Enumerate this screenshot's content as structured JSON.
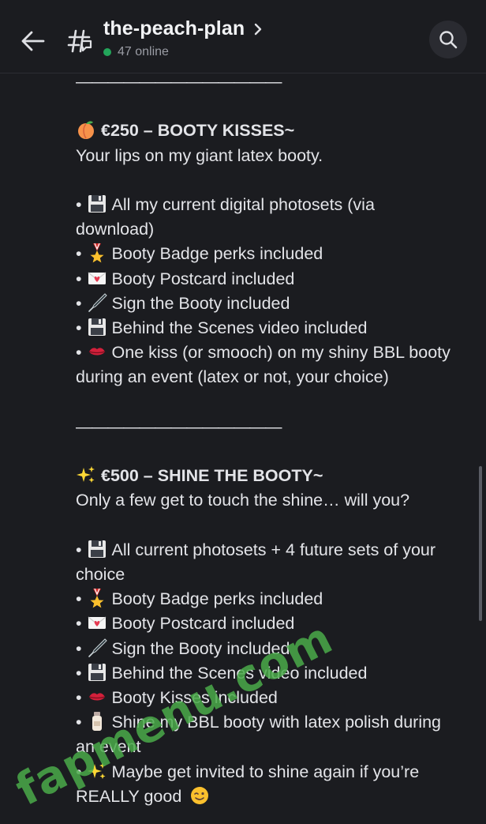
{
  "header": {
    "back_icon": "arrow-left-icon",
    "channel_icon": "hash-thread-icon",
    "channel_name": "the-peach-plan",
    "chevron_icon": "chevron-right-icon",
    "online_text": "47 online",
    "online_color": "#23a55a",
    "search_icon": "search-icon"
  },
  "message": {
    "divider_1": "—————————————",
    "tier_1": {
      "emoji": "peach-icon",
      "title": "€250 – BOOTY KISSES~",
      "subtitle": "Your lips on my giant latex booty.",
      "items": [
        {
          "emoji": "floppy-disk-icon",
          "text": "All my current digital photosets (via",
          "cont": "download)"
        },
        {
          "emoji": "military-medal-icon",
          "text": "Booty Badge perks included"
        },
        {
          "emoji": "love-letter-icon",
          "text": "Booty Postcard included"
        },
        {
          "emoji": "fountain-pen-icon",
          "text": "Sign the Booty included"
        },
        {
          "emoji": "floppy-disk-icon",
          "text": "Behind the Scenes video included"
        },
        {
          "emoji": "kiss-lips-icon",
          "text": "One kiss (or smooch) on my shiny BBL booty",
          "cont": "during an event (latex or not, your choice)"
        }
      ]
    },
    "divider_2": "—————————————",
    "tier_2": {
      "emoji": "sparkles-icon",
      "title": "€500 – SHINE THE BOOTY~",
      "subtitle": "Only a few get to touch the shine… will you?",
      "items": [
        {
          "emoji": "floppy-disk-icon",
          "text": "All current photosets + 4 future sets of your",
          "cont": "choice"
        },
        {
          "emoji": "military-medal-icon",
          "text": "Booty Badge perks included"
        },
        {
          "emoji": "love-letter-icon",
          "text": "Booty Postcard included"
        },
        {
          "emoji": "fountain-pen-icon",
          "text": "Sign the Booty included"
        },
        {
          "emoji": "floppy-disk-icon",
          "text": "Behind the Scenes video included"
        },
        {
          "emoji": "kiss-lips-icon",
          "text": "Booty Kisses included"
        },
        {
          "emoji": "lotion-bottle-icon",
          "text": "Shine my BBL booty with latex polish during",
          "cont": "an event"
        },
        {
          "emoji": "sparkles-icon",
          "text": "Maybe get invited to shine again if you’re",
          "cont": "REALLY good",
          "end_emoji": "winking-face-icon"
        }
      ]
    }
  },
  "watermark": "fapmenu.com",
  "colors": {
    "background": "#1b1c20",
    "text": "#e3e4e8",
    "watermark": "#4aaa4a"
  }
}
